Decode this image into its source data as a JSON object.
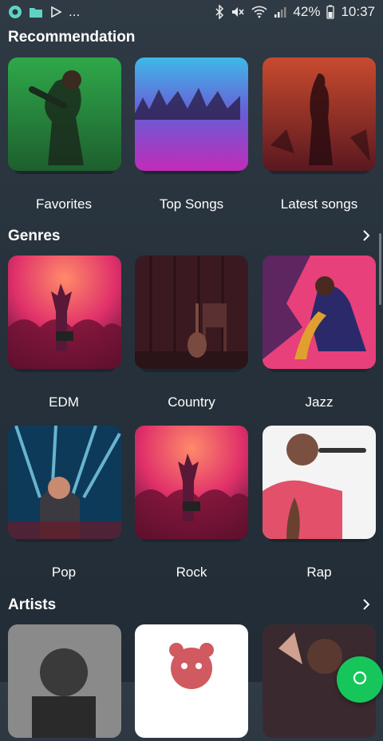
{
  "status_bar": {
    "battery": "42%",
    "time": "10:37",
    "more": "...",
    "left_icons": [
      "app-notification-icon",
      "folder-icon",
      "play-store-icon"
    ],
    "right_icons": [
      "bluetooth-icon",
      "mute-icon",
      "wifi-icon",
      "signal-icon",
      "battery-icon"
    ]
  },
  "recommendation": {
    "title": "Recommendation",
    "items": [
      {
        "label": "Favorites"
      },
      {
        "label": "Top Songs"
      },
      {
        "label": "Latest songs"
      }
    ]
  },
  "genres": {
    "title": "Genres",
    "items": [
      {
        "label": "EDM"
      },
      {
        "label": "Country"
      },
      {
        "label": "Jazz"
      },
      {
        "label": "Pop"
      },
      {
        "label": "Rock"
      },
      {
        "label": "Rap"
      }
    ]
  },
  "artists": {
    "title": "Artists"
  },
  "colors": {
    "background": "#26313b",
    "accent_green": "#17c65a",
    "text": "#ffffff"
  }
}
